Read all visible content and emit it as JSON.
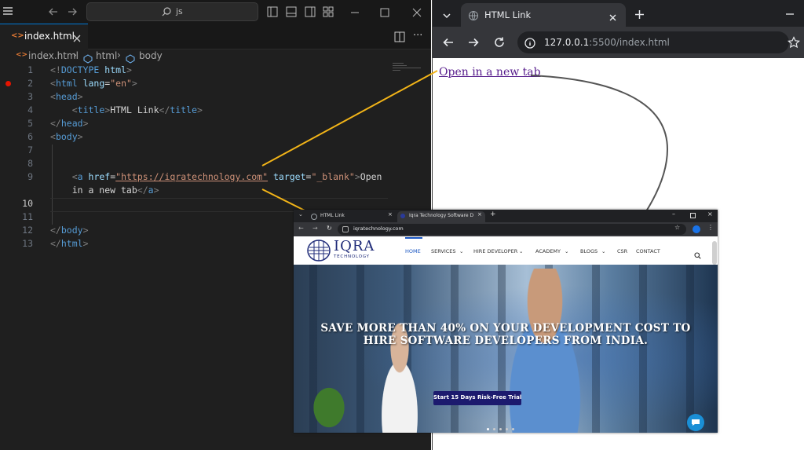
{
  "editor": {
    "search_box": "js",
    "tab_label": "index.html",
    "breadcrumb": [
      "index.html",
      "html",
      "body"
    ],
    "lines": [
      {
        "n": "1",
        "segments": [
          [
            "punc",
            "<!"
          ],
          [
            "tag",
            "DOCTYPE"
          ],
          [
            "txt",
            " "
          ],
          [
            "attr",
            "html"
          ],
          [
            "punc",
            ">"
          ]
        ]
      },
      {
        "n": "2",
        "segments": [
          [
            "punc",
            "<"
          ],
          [
            "tag",
            "html"
          ],
          [
            "txt",
            " "
          ],
          [
            "attr",
            "lang"
          ],
          [
            "txt",
            "="
          ],
          [
            "str",
            "\"en\""
          ],
          [
            "punc",
            ">"
          ]
        ]
      },
      {
        "n": "3",
        "segments": [
          [
            "punc",
            "<"
          ],
          [
            "tag",
            "head"
          ],
          [
            "punc",
            ">"
          ]
        ]
      },
      {
        "n": "4",
        "segments": [
          [
            "txt",
            "    "
          ],
          [
            "punc",
            "<"
          ],
          [
            "tag",
            "title"
          ],
          [
            "punc",
            ">"
          ],
          [
            "txt",
            "HTML Link"
          ],
          [
            "punc",
            "</"
          ],
          [
            "tag",
            "title"
          ],
          [
            "punc",
            ">"
          ]
        ]
      },
      {
        "n": "5",
        "segments": [
          [
            "punc",
            "</"
          ],
          [
            "tag",
            "head"
          ],
          [
            "punc",
            ">"
          ]
        ]
      },
      {
        "n": "6",
        "segments": [
          [
            "punc",
            "<"
          ],
          [
            "tag",
            "body"
          ],
          [
            "punc",
            ">"
          ]
        ]
      },
      {
        "n": "7",
        "segments": []
      },
      {
        "n": "8",
        "segments": []
      },
      {
        "n": "9",
        "segments": [
          [
            "txt",
            "    "
          ],
          [
            "punc",
            "<"
          ],
          [
            "tag",
            "a"
          ],
          [
            "txt",
            " "
          ],
          [
            "attr",
            "href"
          ],
          [
            "txt",
            "="
          ],
          [
            "str",
            "\"https://iqratechnology.com\""
          ],
          [
            "txt",
            " "
          ],
          [
            "attr",
            "target"
          ],
          [
            "txt",
            "="
          ],
          [
            "str",
            "\"_blank\""
          ],
          [
            "punc",
            ">"
          ],
          [
            "txt",
            "Open"
          ]
        ]
      },
      {
        "n": "",
        "segments": [
          [
            "txt",
            "    in a new tab"
          ],
          [
            "punc",
            "</"
          ],
          [
            "tag",
            "a"
          ],
          [
            "punc",
            ">"
          ]
        ]
      },
      {
        "n": "10",
        "segments": [],
        "active": true
      },
      {
        "n": "11",
        "segments": []
      },
      {
        "n": "12",
        "segments": [
          [
            "punc",
            "</"
          ],
          [
            "tag",
            "body"
          ],
          [
            "punc",
            ">"
          ]
        ]
      },
      {
        "n": "13",
        "segments": [
          [
            "punc",
            "</"
          ],
          [
            "tag",
            "html"
          ],
          [
            "punc",
            ">"
          ]
        ]
      }
    ]
  },
  "browser": {
    "tab_title": "HTML Link",
    "url_host": "127.0.0.1",
    "url_rest": ":5500/index.html",
    "link_text": "Open in a new tab"
  },
  "inset": {
    "tab1": "HTML Link",
    "tab2": "Iqra Technology Software Dev",
    "url": "iqratechnology.com",
    "logo_main": "IQRA",
    "logo_sub": "TECHNOLOGY",
    "nav": [
      "HOME",
      "SERVICES",
      "HIRE DEVELOPER",
      "ACADEMY",
      "BLOGS",
      "CSR",
      "CONTACT"
    ],
    "headline_1": "SAVE MORE THAN 40% ON YOUR DEVELOPMENT COST TO",
    "headline_2": "HIRE SOFTWARE DEVELOPERS FROM INDIA.",
    "cta": "Start 15 Days Risk-Free Trial"
  },
  "colors": {
    "vscode_bg": "#1f1f1f",
    "accent_blue": "#0078d4",
    "callout_yellow": "#f2b418",
    "callout_gray": "#555555",
    "cta_bg": "#1c1a6e",
    "visited_link": "#551a8b"
  }
}
